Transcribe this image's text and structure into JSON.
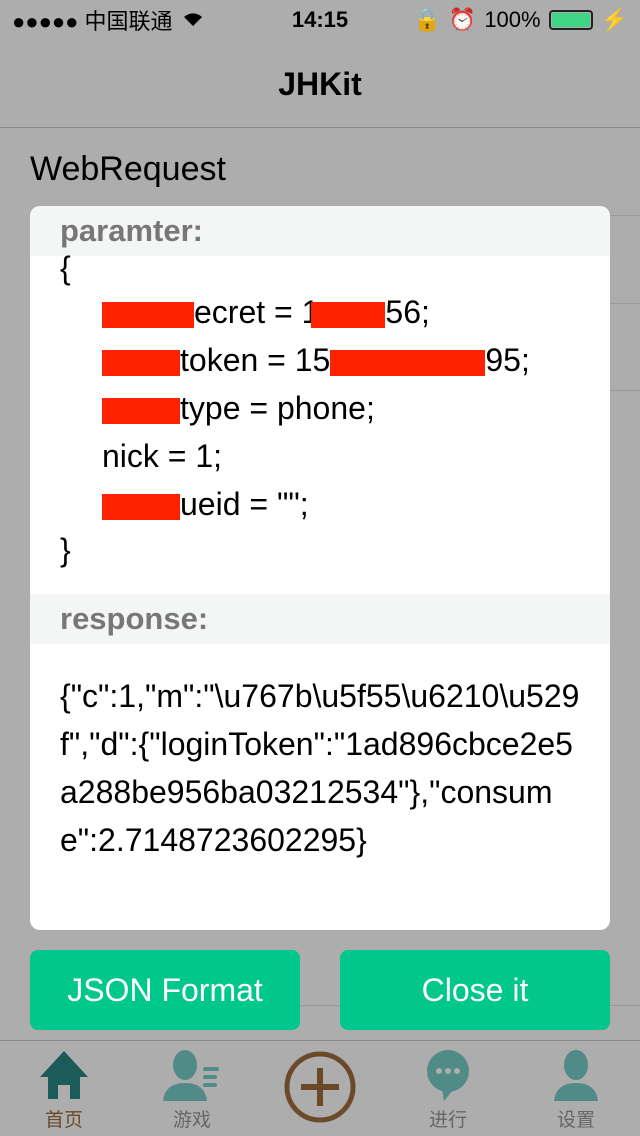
{
  "status_bar": {
    "carrier": "●●●●● 中国联通",
    "time": "14:15",
    "battery": "100%",
    "battery_level": 1.0
  },
  "nav": {
    "title": "JHKit"
  },
  "list": {
    "section_title": "WebRequest"
  },
  "dialog": {
    "param_header": "paramter:",
    "param_open": "{",
    "param_lines": [
      {
        "a": "ecret = 1",
        "b": "56;"
      },
      {
        "a": "token = 15",
        "b": "95;"
      },
      {
        "a": "type = phone;"
      },
      {
        "a": "nick = 1;"
      },
      {
        "a": "ueid = \"\";"
      }
    ],
    "param_close": "}",
    "response_header": "response:",
    "response_text": "{\"c\":1,\"m\":\"\\u767b\\u5f55\\u6210\\u529f\",\"d\":{\"loginToken\":\"1ad896cbce2e5a288be956ba03212534\"},\"consume\":2.7148723602295}"
  },
  "buttons": {
    "json_format": "JSON Format",
    "close": "Close it"
  },
  "colors": {
    "accent": "#00c78c",
    "redaction": "#ff2200",
    "tab_icon": "#508b87",
    "tab_active": "#6b4a2a"
  },
  "tabbar": {
    "items": [
      {
        "label": "首页",
        "icon": "home-icon"
      },
      {
        "label": "游戏",
        "icon": "user-list-icon"
      },
      {
        "label": "",
        "icon": "plus-circle-icon"
      },
      {
        "label": "进行",
        "icon": "chat-bubble-icon"
      },
      {
        "label": "设置",
        "icon": "user-icon"
      }
    ]
  }
}
